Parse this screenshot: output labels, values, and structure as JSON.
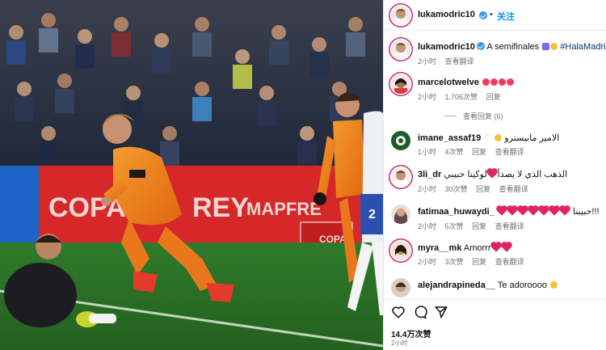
{
  "photo": {
    "banner_left": "COPA",
    "banner_rey": "REY",
    "banner_sponsor": "MAPFRE",
    "banner_small": "COPA",
    "player_number": "2"
  },
  "header": {
    "username": "lukamodric10",
    "separator": "•",
    "follow_label": "关注"
  },
  "caption": {
    "username": "lukamodric10",
    "text": "A semifinales",
    "hashtag": "#HalaMadrid",
    "time": "2小时",
    "translate": "查看翻译"
  },
  "comments": [
    {
      "username": "marcelotwelve",
      "text": "",
      "time": "2小时",
      "likes": "1,706次赞",
      "reply": "回复",
      "translate": ""
    },
    {
      "username": "imane_assaf19",
      "text": "الامير مابيسترو",
      "time": "1小时",
      "likes": "4次赞",
      "reply": "回复",
      "translate": "查看翻译"
    },
    {
      "username": "3li_dr",
      "text": "الذهب الذي لا يصدأ",
      "text2": "لوكيتا حبيبي",
      "time": "2小时",
      "likes": "30次赞",
      "reply": "回复",
      "translate": "查看翻译"
    },
    {
      "username": "fatimaa_huwaydi_",
      "text": "حبيبنا!!!",
      "time": "2小时",
      "likes": "5次赞",
      "reply": "回复",
      "translate": "查看翻译"
    },
    {
      "username": "myra__mk",
      "text": "Amorrr",
      "time": "2小时",
      "likes": "3次赞",
      "reply": "回复",
      "translate": "查看翻译"
    },
    {
      "username": "alejandrapineda__",
      "text": "Te adoroooo",
      "time": "",
      "likes": "",
      "reply": "",
      "translate": ""
    }
  ],
  "view_replies": "查看回复 (6)",
  "footer": {
    "likes": "14.4万次赞",
    "time": "2小时"
  },
  "colors": {
    "accent": "#0095f6",
    "verified": "#3897f0",
    "heart": "#e0245e",
    "kit_orange": "#f07a1a"
  }
}
